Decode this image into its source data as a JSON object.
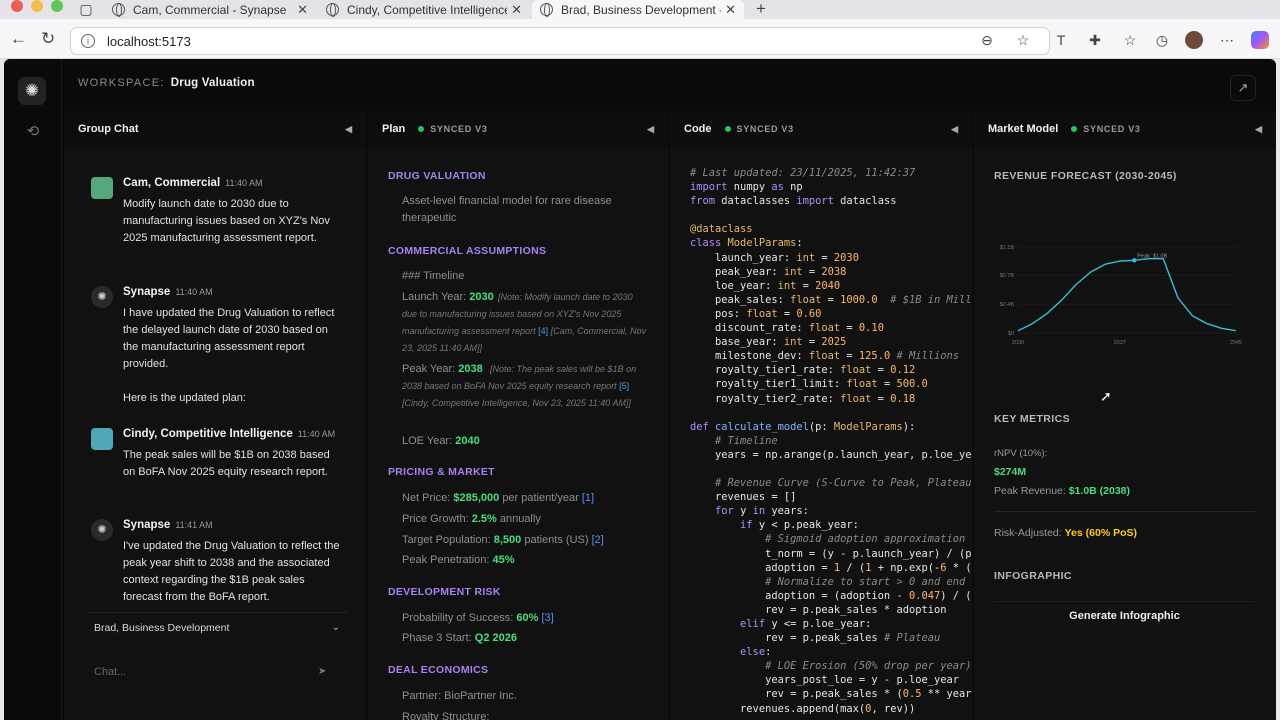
{
  "browser": {
    "tabs": [
      {
        "label": "Cam, Commercial - Synapse"
      },
      {
        "label": "Cindy, Competitive Intelligence"
      },
      {
        "label": "Brad, Business Development - S"
      }
    ],
    "url": "localhost:5173"
  },
  "workspace": {
    "prefix": "WORKSPACE:",
    "name": "Drug Valuation"
  },
  "chat": {
    "title": "Group Chat",
    "messages": [
      {
        "author": "Cam, Commercial",
        "time": "11:40 AM",
        "text": "Modify launch date to 2030 due to manufacturing issues based on XYZ's Nov 2025 manufacturing assessment report."
      },
      {
        "author": "Synapse",
        "time": "11:40 AM",
        "text": "I have updated the Drug Valuation to reflect the delayed launch date of 2030 based on the manufacturing assessment report provided.",
        "text2": "Here is the updated plan:"
      },
      {
        "author": "Cindy, Competitive Intelligence",
        "time": "11:40 AM",
        "text": "The peak sales will be $1B on 2038 based on BoFA Nov 2025 equity research report."
      },
      {
        "author": "Synapse",
        "time": "11:41 AM",
        "text": "I've updated the Drug Valuation to reflect the peak year shift to 2038 and the associated context regarding the $1B peak sales forecast from the BoFA report."
      }
    ],
    "user": "Brad, Business Development",
    "placeholder": "Chat..."
  },
  "plan": {
    "title": "Plan",
    "sync": "SYNCED V3",
    "drug_valuation": "DRUG VALUATION",
    "desc": "Asset-level financial model for rare disease therapeutic",
    "commercial": "COMMERCIAL ASSUMPTIONS",
    "timeline": "### Timeline",
    "launch_label": "Launch Year:",
    "launch_value": "2030",
    "launch_note": "[Note: Modify launch date to 2030 due to manufacturing issues based on XYZ's Nov 2025 manufacturing assessment report",
    "launch_ref": "[4]",
    "launch_attr": "[Cam, Commercial, Nov 23, 2025 11:40 AM]]",
    "peak_label": "Peak Year:",
    "peak_value": "2038",
    "peak_note": "[Note: The peak sales will be $1B on 2038 based on BoFA Nov 2025 equity research report",
    "peak_ref": "[5]",
    "peak_attr": "[Cindy, Competitive Intelligence, Nov 23, 2025 11:40 AM]]",
    "loe_label": "LOE Year:",
    "loe_value": "2040",
    "pricing": "PRICING & MARKET",
    "price_label": "Net Price:",
    "price_value": "$285,000",
    "price_suffix": "per patient/year",
    "price_ref": "[1]",
    "growth_label": "Price Growth:",
    "growth_value": "2.5%",
    "growth_suffix": "annually",
    "pop_label": "Target Population:",
    "pop_value": "8,500",
    "pop_suffix": "patients (US)",
    "pop_ref": "[2]",
    "pen_label": "Peak Penetration:",
    "pen_value": "45%",
    "dev": "DEVELOPMENT RISK",
    "pos_label": "Probability of Success:",
    "pos_value": "60%",
    "pos_ref": "[3]",
    "p3_label": "Phase 3 Start:",
    "p3_value": "Q2 2026",
    "deal": "DEAL ECONOMICS",
    "partner": "Partner: BioPartner Inc.",
    "royalty": "Royalty Structure:"
  },
  "code": {
    "title": "Code",
    "sync": "SYNCED V3"
  },
  "market": {
    "title": "Market Model",
    "sync": "SYNCED V3",
    "forecast": "REVENUE FORECAST (2030-2045)",
    "key_metrics": "KEY METRICS",
    "rnpv_label": "rNPV (10%):",
    "rnpv_value": "$274M",
    "peak_label": "Peak Revenue:",
    "peak_value": "$1.0B (2038)",
    "risk_label": "Risk-Adjusted:",
    "risk_value": "Yes (60% PoS)",
    "infographic": "INFOGRAPHIC",
    "generate": "Generate Infographic"
  },
  "chart_data": {
    "type": "line",
    "x": [
      2030,
      2031,
      2032,
      2033,
      2034,
      2035,
      2036,
      2037,
      2038,
      2039,
      2040,
      2041,
      2042,
      2043,
      2044,
      2045
    ],
    "y": [
      0.03,
      0.12,
      0.25,
      0.42,
      0.62,
      0.78,
      0.88,
      0.92,
      0.93,
      0.95,
      0.95,
      0.45,
      0.22,
      0.12,
      0.06,
      0.03
    ],
    "xticks": [
      "2030",
      "2037",
      "2045"
    ],
    "yticks": [
      "$0",
      "$0.4B",
      "$0.7B",
      "$1.1B"
    ],
    "ylim": [
      0,
      1.1
    ],
    "annotation": "Peak: $1.0B"
  }
}
